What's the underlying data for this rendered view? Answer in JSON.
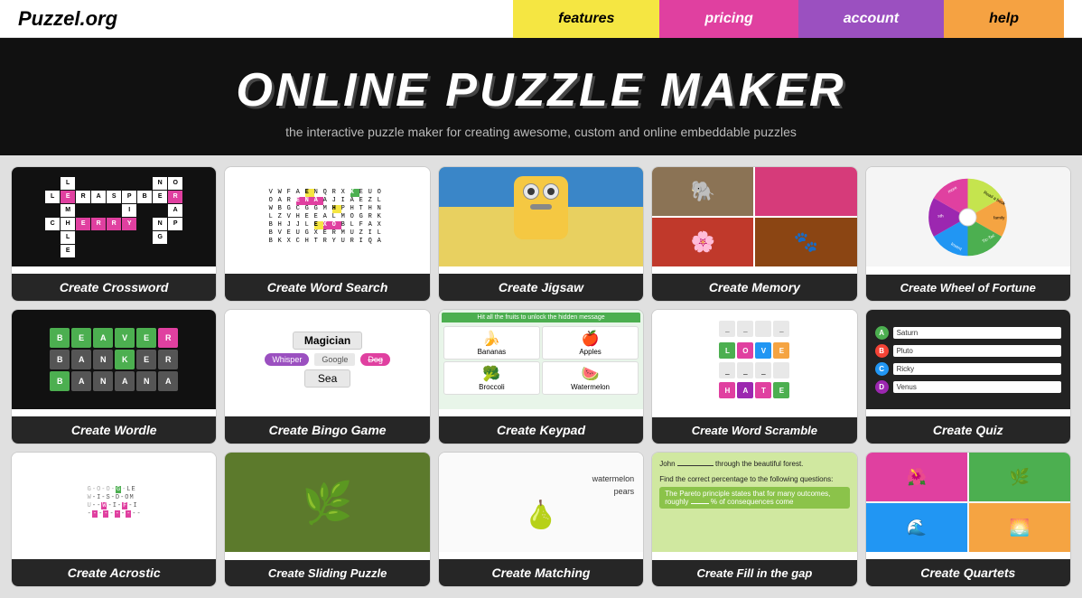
{
  "header": {
    "logo": "Puzzel.org",
    "nav": [
      {
        "id": "features",
        "label": "features",
        "class": "nav-features"
      },
      {
        "id": "pricing",
        "label": "pricing",
        "class": "nav-pricing"
      },
      {
        "id": "account",
        "label": "account",
        "class": "nav-account"
      },
      {
        "id": "help",
        "label": "help",
        "class": "nav-help"
      }
    ]
  },
  "hero": {
    "title": "ONLINE PUZZLE MAKER",
    "subtitle": "the interactive puzzle maker for creating awesome, custom and online embeddable puzzles"
  },
  "puzzles": [
    {
      "id": "crossword",
      "label": "Create Crossword",
      "row": 1
    },
    {
      "id": "wordsearch",
      "label": "Create Word Search",
      "row": 1
    },
    {
      "id": "jigsaw",
      "label": "Create Jigsaw",
      "row": 1
    },
    {
      "id": "memory",
      "label": "Create Memory",
      "row": 1
    },
    {
      "id": "wheeloffortune",
      "label": "Create Wheel of Fortune",
      "row": 1
    },
    {
      "id": "wordle",
      "label": "Create Wordle",
      "row": 2
    },
    {
      "id": "bingo",
      "label": "Create Bingo Game",
      "row": 2
    },
    {
      "id": "keypad",
      "label": "Create Keypad",
      "row": 2
    },
    {
      "id": "wordscramble",
      "label": "Create Word Scramble",
      "row": 2
    },
    {
      "id": "quiz",
      "label": "Create Quiz",
      "row": 2
    },
    {
      "id": "acrostic",
      "label": "Create Acrostic",
      "row": 3
    },
    {
      "id": "sliding",
      "label": "Create Sliding Puzzle",
      "row": 3
    },
    {
      "id": "matching",
      "label": "Create Matching",
      "row": 3
    },
    {
      "id": "fillin",
      "label": "Create Fill in the gap",
      "row": 3
    },
    {
      "id": "quartets",
      "label": "Create Quartets",
      "row": 3
    }
  ],
  "wheel": {
    "segments": [
      {
        "label": "Read a book",
        "color": "#c5e44e"
      },
      {
        "label": "family time",
        "color": "#f5a442"
      },
      {
        "label": "Tic-Tac-Toe",
        "color": "#4caf50"
      },
      {
        "label": "Invent sth",
        "color": "#2196f3"
      },
      {
        "label": "something",
        "color": "#9c27b0"
      },
      {
        "label": "something2",
        "color": "#e040a0"
      }
    ]
  },
  "quiz_options": [
    {
      "letter": "A",
      "text": "Saturn",
      "color": "#4caf50"
    },
    {
      "letter": "B",
      "text": "Pluto",
      "color": "#f44336"
    },
    {
      "letter": "C",
      "text": "Ricky",
      "color": "#2196f3"
    },
    {
      "letter": "D",
      "text": "Venus",
      "color": "#9c27b0"
    }
  ],
  "bingo": {
    "word1": "Magician",
    "tag1": "Whisper",
    "tag2": "Google",
    "tag3": "Dog",
    "word2": "Sea"
  },
  "keypad": {
    "header": "Hit all the fruits to unlock the hidden message",
    "items": [
      "Bananas",
      "Apples",
      "Broccoli",
      "Watermelon"
    ]
  }
}
